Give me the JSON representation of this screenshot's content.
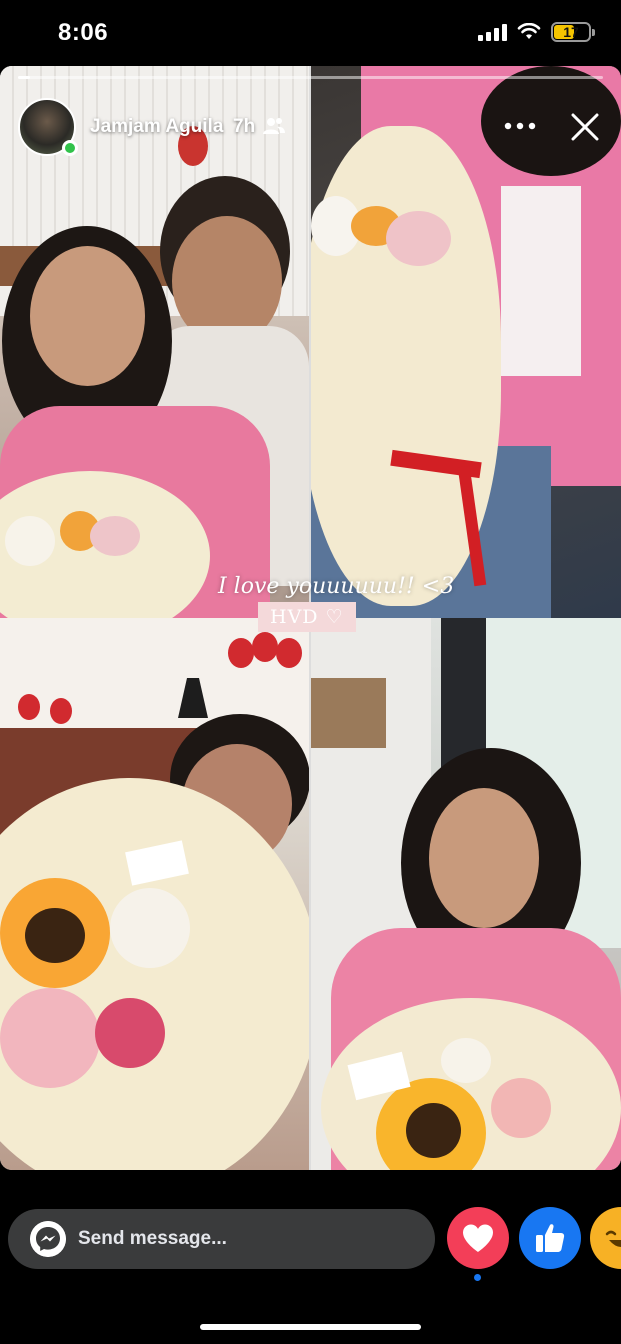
{
  "status_bar": {
    "time": "8:06",
    "battery": "17",
    "battery_color": "#f5c400"
  },
  "story": {
    "author": "Jamjam Aguila",
    "time_ago": "7h",
    "audience_icon": "friends-icon",
    "caption": "I love youuuuuu!! <3",
    "badge": "HVD ♡",
    "progress_fraction": 0.02
  },
  "footer": {
    "message_placeholder": "Send message...",
    "reactions": [
      {
        "name": "love",
        "icon": "heart-icon",
        "color": "#f33e58"
      },
      {
        "name": "like",
        "icon": "thumbs-up-icon",
        "color": "#1877f2"
      },
      {
        "name": "haha",
        "icon": "laughing-face-icon",
        "color": "#f7b125"
      }
    ]
  }
}
